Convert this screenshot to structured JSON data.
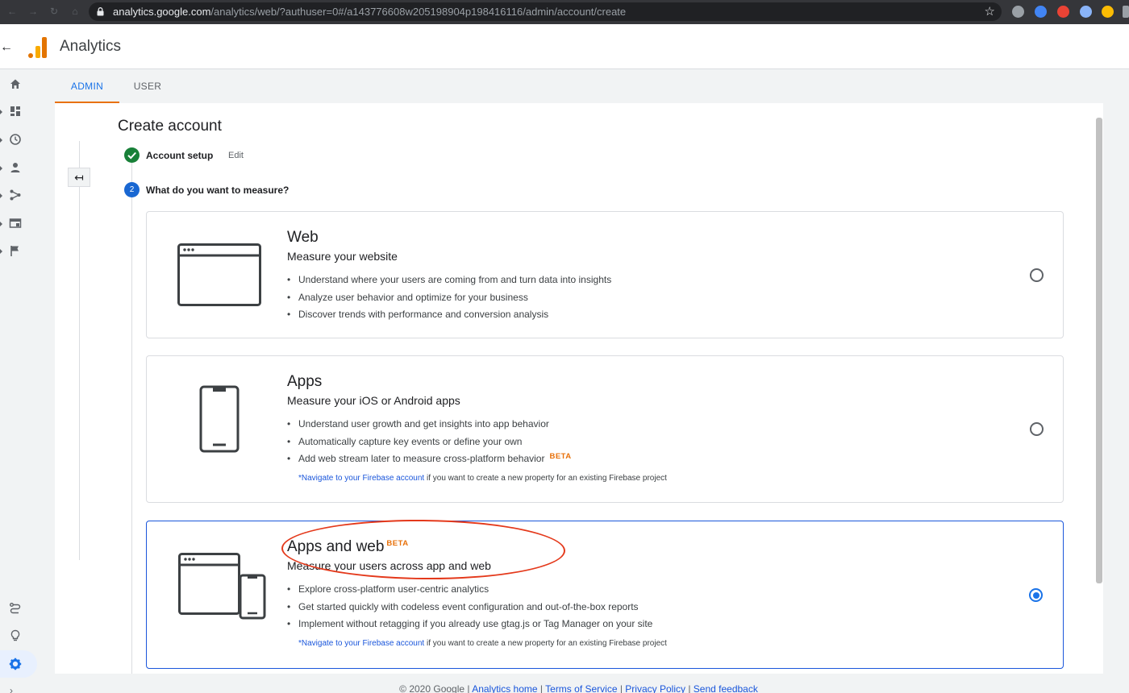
{
  "browser": {
    "url_domain": "analytics.google.com",
    "url_path": "/analytics/web/?authuser=0#/a143776608w205198904p198416116/admin/account/create"
  },
  "app": {
    "title": "Analytics",
    "brand_colors": [
      "#f9ab00",
      "#e37400"
    ]
  },
  "left_nav": {
    "icons": [
      "home-icon",
      "dashboard-icon",
      "clock-icon",
      "person-icon",
      "acquisition-icon",
      "behavior-icon",
      "flag-icon",
      "route-icon",
      "lightbulb-icon",
      "gear-icon"
    ],
    "active": "gear-icon"
  },
  "tabs": [
    {
      "label": "ADMIN",
      "active": true
    },
    {
      "label": "USER",
      "active": false
    }
  ],
  "page": {
    "title": "Create account",
    "steps": [
      {
        "label": "Account setup",
        "status": "complete",
        "action": "Edit"
      },
      {
        "number": "2",
        "label": "What do you want to measure?",
        "status": "current"
      }
    ]
  },
  "options": [
    {
      "title": "Web",
      "subtitle": "Measure your website",
      "bullets": [
        "Understand where your users are coming from and turn data into insights",
        "Analyze user behavior and optimize for your business",
        "Discover trends with performance and conversion analysis"
      ],
      "selected": false
    },
    {
      "title": "Apps",
      "subtitle": "Measure your iOS or Android apps",
      "bullets": [
        "Understand user growth and get insights into app behavior",
        "Automatically capture key events or define your own",
        "Add web stream later to measure cross-platform behavior"
      ],
      "bullet_badge": "BETA",
      "note_link": "*Navigate to your Firebase account",
      "note_text": " if you want to create a new property for an existing Firebase project",
      "selected": false
    },
    {
      "title": "Apps and web",
      "title_badge": "BETA",
      "subtitle": "Measure your users across app and web",
      "bullets": [
        "Explore cross-platform user-centric analytics",
        "Get started quickly with codeless event configuration and out-of-the-box reports",
        "Implement without retagging if you already use gtag.js or Tag Manager on your site"
      ],
      "note_link": "*Navigate to your Firebase account",
      "note_text": " if you want to create a new property for an existing Firebase project",
      "selected": true
    }
  ],
  "footer": {
    "copyright": "© 2020 Google",
    "sep": " | ",
    "links": [
      "Analytics home",
      "Terms of Service",
      "Privacy Policy",
      "Send feedback"
    ]
  },
  "colors": {
    "accent_blue": "#1a73e8",
    "tab_underline": "#e8710a",
    "beta": "#e8710a",
    "annotation_red": "#e4391b",
    "step_complete": "#188038"
  }
}
